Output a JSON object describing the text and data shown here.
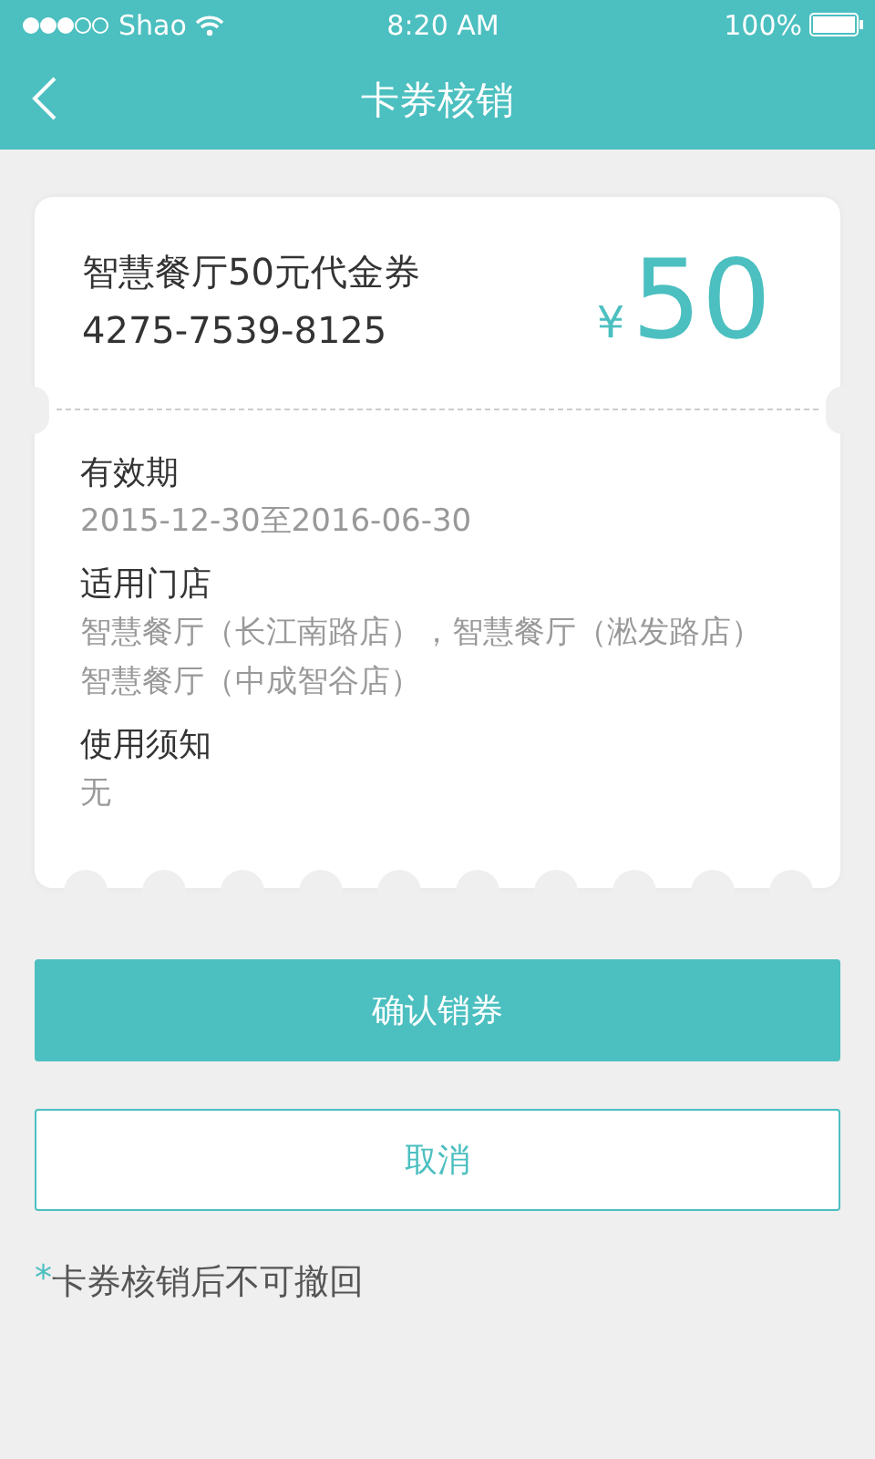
{
  "status_bar": {
    "carrier": "Shao",
    "time": "8:20 AM",
    "battery": "100%"
  },
  "nav": {
    "title": "卡券核销"
  },
  "coupon": {
    "name": "智慧餐厅50元代金券",
    "code": "4275-7539-8125",
    "currency": "¥",
    "amount": "50",
    "details": [
      {
        "label": "有效期",
        "lines": [
          "2015-12-30至2016-06-30"
        ]
      },
      {
        "label": "适用门店",
        "lines": [
          "智慧餐厅（长江南路店），智慧餐厅（淞发路店）",
          "智慧餐厅（中成智谷店）"
        ]
      },
      {
        "label": "使用须知",
        "lines": [
          "无"
        ]
      }
    ]
  },
  "buttons": [
    {
      "label": "确认销券",
      "kind": "primary"
    },
    {
      "label": "取消",
      "kind": "secondary"
    }
  ],
  "note": {
    "mark": "*",
    "text": "卡券核销后不可撤回"
  }
}
